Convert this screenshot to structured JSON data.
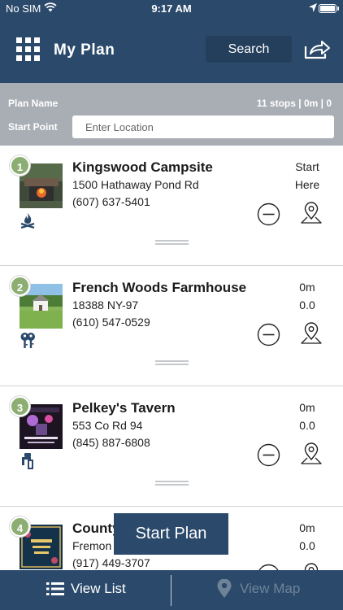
{
  "status_bar": {
    "carrier": "No SIM",
    "time": "9:17 AM"
  },
  "header": {
    "title": "My Plan",
    "search_label": "Search",
    "menu_icon": "grid-menu-icon",
    "share_icon": "share-icon"
  },
  "plan": {
    "name_label": "Plan Name",
    "stats": "11 stops | 0m | 0",
    "start_point_label": "Start Point",
    "start_point_placeholder": "Enter Location"
  },
  "stops": [
    {
      "number": "1",
      "name": "Kingswood Campsite",
      "address": "1500 Hathaway Pond Rd",
      "phone": "(607) 637-5401",
      "distance": "Start",
      "time": "Here",
      "category_icon": "campfire-icon"
    },
    {
      "number": "2",
      "name": "French Woods Farmhouse",
      "address": "18388 NY-97",
      "phone": "(610) 547-0529",
      "distance": "0m",
      "time": "0.0",
      "category_icon": "keys-icon"
    },
    {
      "number": "3",
      "name": "Pelkey's Tavern",
      "address": "553 Co Rd 94",
      "phone": "(845) 887-6808",
      "distance": "0m",
      "time": "0.0",
      "category_icon": "beer-tap-icon"
    },
    {
      "number": "4",
      "name": "County",
      "address": "Fremon",
      "phone": "(917) 449-3707",
      "distance": "0m",
      "time": "0.0",
      "category_icon": "bakery-icon"
    }
  ],
  "start_plan_label": "Start Plan",
  "bottom_nav": {
    "view_list": "View List",
    "view_map": "View Map"
  },
  "colors": {
    "primary": "#2b4a6b",
    "plan_bar": "#a9aeb5",
    "badge": "#8cae72",
    "disabled_text": "#6f8398"
  }
}
